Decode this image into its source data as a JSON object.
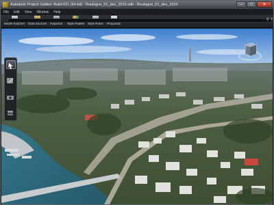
{
  "window": {
    "title": "Autodesk Project Galileo: Build 621 (64-bit) - Boulogne_01_dec_2010.sdb - Boulogne_01_dec_2010",
    "controls": [
      "–",
      "□",
      "✕"
    ]
  },
  "menu": [
    "File",
    "Edit",
    "View",
    "Window",
    "Help"
  ],
  "toolbar": [
    {
      "label": "Model Explorer",
      "icon": "model-explorer-icon"
    },
    {
      "label": "Data Sources",
      "icon": "data-sources-icon"
    },
    {
      "label": "Inspector",
      "icon": "inspector-icon"
    },
    {
      "label": "Style Palette",
      "icon": "style-palette-icon"
    },
    {
      "label": "Style Rules",
      "icon": "style-rules-icon"
    },
    {
      "label": "Proposals",
      "icon": "proposals-icon"
    }
  ],
  "search": {
    "placeholder": ""
  },
  "side_tools": [
    {
      "icon": "select-icon",
      "active": true
    },
    {
      "icon": "edit-icon",
      "active": false
    },
    {
      "icon": "camera-icon",
      "active": false
    },
    {
      "icon": "layers-icon",
      "active": false
    }
  ],
  "colors": {
    "title_bar": "#50555b",
    "close": "#c4472f",
    "sky": "#6f9fd6",
    "river": "#2f6b7e"
  }
}
